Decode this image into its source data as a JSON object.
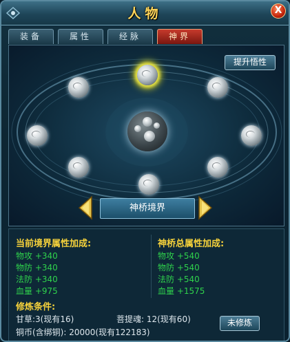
{
  "window": {
    "title": "人物"
  },
  "tabs": [
    {
      "label": "装备"
    },
    {
      "label": "属性"
    },
    {
      "label": "经脉"
    },
    {
      "label": "神界"
    }
  ],
  "active_tab": "神界",
  "scene": {
    "upgrade_button": "提升悟性",
    "realm_name": "神桥境界"
  },
  "current_bonus": {
    "header": "当前境界属性加成:",
    "stats": [
      {
        "text": "物攻 +340"
      },
      {
        "text": "物防 +340"
      },
      {
        "text": "法防 +340"
      },
      {
        "text": "血量 +975"
      }
    ]
  },
  "total_bonus": {
    "header": "神桥总属性加成:",
    "stats": [
      {
        "text": "物攻 +540"
      },
      {
        "text": "物防 +540"
      },
      {
        "text": "法防 +540"
      },
      {
        "text": "血量 +1575"
      }
    ]
  },
  "conditions": {
    "header": "修炼条件:",
    "gancao": "甘草:3(现有16)",
    "putihun": "菩提魂: 12(现有60)",
    "coins": "铜币(含绑铜): 20000(现有122183)",
    "button": "未修炼"
  },
  "colors": {
    "accent": "#f6d23b",
    "stat_green": "#2fd24c",
    "active_tab": "#c63a2c"
  }
}
